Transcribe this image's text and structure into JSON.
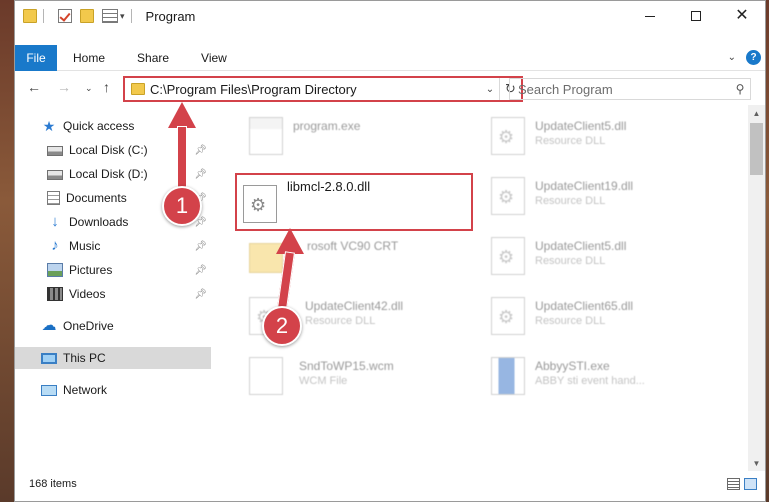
{
  "window": {
    "title": "Program"
  },
  "ribbon": {
    "tabs": [
      "File",
      "Home",
      "Share",
      "View"
    ]
  },
  "address": {
    "path": "C:\\Program Files\\Program Directory"
  },
  "search": {
    "placeholder": "Search Program"
  },
  "sidebar": {
    "items": [
      {
        "label": "Quick access",
        "icon": "star-icon"
      },
      {
        "label": "Local Disk (C:)",
        "icon": "disk-icon",
        "pinned": true
      },
      {
        "label": "Local Disk (D:)",
        "icon": "disk-icon",
        "pinned": true
      },
      {
        "label": "Documents",
        "icon": "documents-icon",
        "pinned": true
      },
      {
        "label": "Downloads",
        "icon": "download-icon",
        "pinned": true
      },
      {
        "label": "Music",
        "icon": "music-icon",
        "pinned": true
      },
      {
        "label": "Pictures",
        "icon": "pictures-icon",
        "pinned": true
      },
      {
        "label": "Videos",
        "icon": "videos-icon",
        "pinned": true
      },
      {
        "label": "OneDrive",
        "icon": "cloud-icon"
      },
      {
        "label": "This PC",
        "icon": "pc-icon",
        "selected": true
      },
      {
        "label": "Network",
        "icon": "network-icon"
      }
    ]
  },
  "files": [
    {
      "name": "program.exe",
      "type": ""
    },
    {
      "name": "UpdateClient5.dll",
      "type": "Resource DLL"
    },
    {
      "name": "libmcl-2.8.0.dll",
      "type": ""
    },
    {
      "name": "UpdateClient19.dll",
      "type": "Resource DLL"
    },
    {
      "name": "rosoft VC90 CRT",
      "type": ""
    },
    {
      "name": "UpdateClient5.dll",
      "type": "Resource DLL"
    },
    {
      "name": "UpdateClient42.dll",
      "type": "Resource DLL"
    },
    {
      "name": "UpdateClient65.dll",
      "type": "Resource DLL"
    },
    {
      "name": "SndToWP15.wcm",
      "type": "WCM File"
    },
    {
      "name": "AbbyySTI.exe",
      "type": "ABBY sti event hand..."
    }
  ],
  "status": {
    "count": "168 items"
  },
  "annotations": {
    "step1": "1",
    "step2": "2"
  },
  "colors": {
    "accent": "#1979ca",
    "highlight": "#d3424a"
  }
}
